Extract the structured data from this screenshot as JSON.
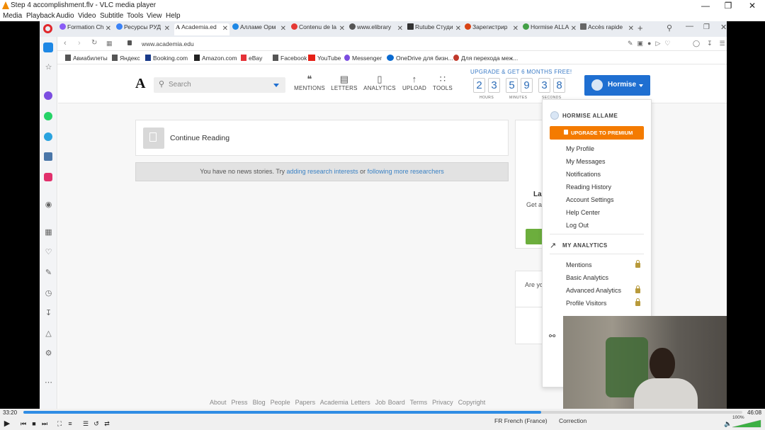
{
  "vlc": {
    "title": "Step 4 accomplishment.flv - VLC media player",
    "menu": [
      "Media",
      "Playback",
      "Audio",
      "Video",
      "Subtitle",
      "Tools",
      "View",
      "Help"
    ],
    "time_elapsed": "33:20",
    "time_total": "46:08",
    "progress": 0.72,
    "volume": "100%",
    "status_language": "FR French (France)",
    "status_correction": "Correction"
  },
  "browser": {
    "tabs": [
      {
        "label": "Formation Ch",
        "color": "#8a5cf6"
      },
      {
        "label": "Ресурсы РУД",
        "color": "#3b82f6"
      },
      {
        "label": "Academia.ed",
        "color": "#222222"
      },
      {
        "label": "Алламе Орм",
        "color": "#1e88e5"
      },
      {
        "label": "Contenu de la",
        "color": "#e53935"
      },
      {
        "label": "www.elibrary",
        "color": "#555555"
      },
      {
        "label": "Rutube Студи",
        "color": "#333333"
      },
      {
        "label": "Зарегистрир",
        "color": "#d84315"
      },
      {
        "label": "Hormise ALLA",
        "color": "#43a047"
      },
      {
        "label": "Accès rapide",
        "color": "#666666"
      }
    ],
    "url": "www.academia.edu",
    "bookmarks": [
      "Авиабилеты",
      "Яндекс",
      "Booking.com",
      "Amazon.com",
      "eBay",
      "Facebook",
      "YouTube",
      "Messenger",
      "OneDrive для бизн...",
      "Для перехода меж..."
    ]
  },
  "academia": {
    "logo": "A",
    "search_placeholder": "Search",
    "nav": [
      {
        "label": "MENTIONS",
        "icon": "mentions-icon"
      },
      {
        "label": "LETTERS",
        "icon": "letters-icon"
      },
      {
        "label": "ANALYTICS",
        "icon": "analytics-icon"
      },
      {
        "label": "UPLOAD",
        "icon": "upload-icon"
      },
      {
        "label": "TOOLS",
        "icon": "tools-icon"
      }
    ],
    "upgrade_banner": "UPGRADE & GET 6 MONTHS FREE!",
    "countdown": {
      "digits": [
        "2",
        "3",
        "5",
        "9",
        "3",
        "8"
      ],
      "labels": [
        "HOURS",
        "MINUTES",
        "SECONDS"
      ]
    },
    "user_button": "Hormise",
    "continue_reading": "Continue Reading",
    "news": {
      "prefix": "You have no news stories. Try",
      "link1": "adding research interests",
      "middle": "or",
      "link2": "following more researchers"
    },
    "right_cards": {
      "la": "La",
      "get_a": "Get a",
      "are_yo": "Are yo"
    },
    "footer": [
      "About",
      "Press",
      "Blog",
      "People",
      "Papers",
      "Academia Letters",
      "Job Board",
      "Terms",
      "Privacy",
      "Copyright"
    ],
    "dropdown": {
      "name": "HORMISE ALLAME",
      "premium": "UPGRADE TO PREMIUM",
      "items": [
        "My Profile",
        "My Messages",
        "Notifications",
        "Reading History",
        "Account Settings",
        "Help Center",
        "Log Out"
      ],
      "analytics_title": "MY ANALYTICS",
      "analytics": [
        {
          "label": "Mentions",
          "locked": true
        },
        {
          "label": "Basic Analytics",
          "locked": false
        },
        {
          "label": "Advanced Analytics",
          "locked": true
        },
        {
          "label": "Profile Visitors",
          "locked": true
        }
      ]
    }
  },
  "colors": {
    "accent": "#1f6fd1",
    "premium": "#f47b00",
    "link": "#3b82c4",
    "seek": "#2f8de4"
  }
}
